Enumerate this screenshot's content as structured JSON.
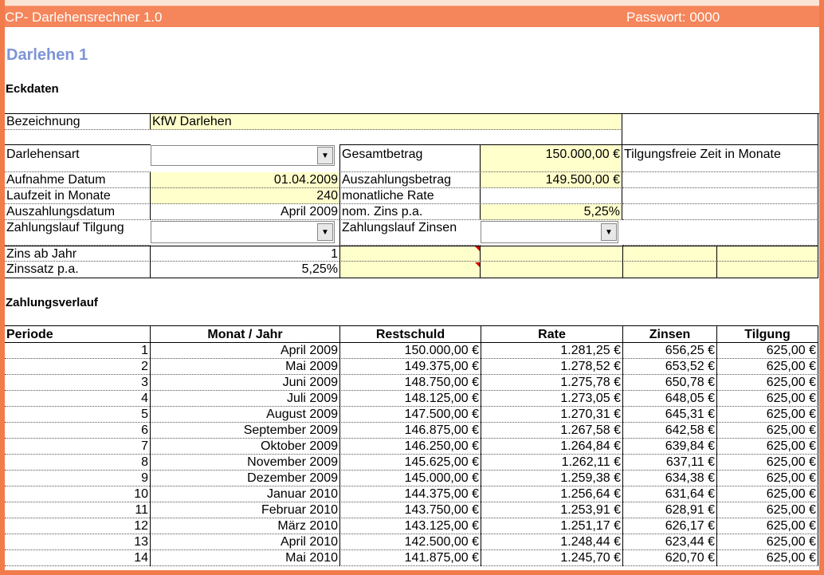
{
  "window": {
    "title": "CP- Darlehensrechner 1.0",
    "password_label": "Passwort: 0000"
  },
  "page_title": "Darlehen 1",
  "section_eckdaten": "Eckdaten",
  "section_zahlungsverlauf": "Zahlungsverlauf",
  "eckdaten": {
    "bezeichnung_label": "Bezeichnung",
    "bezeichnung_value": "KfW Darlehen",
    "darlehensart_label": "Darlehensart",
    "gesamtbetrag_label": "Gesamtbetrag",
    "gesamtbetrag_value": "150.000,00 €",
    "tilgungsfreie_label": "Tilgungsfreie Zeit in Monate",
    "aufnahme_label": "Aufnahme Datum",
    "aufnahme_value": "01.04.2009",
    "auszahlungsbetrag_label": "Auszahlungsbetrag",
    "auszahlungsbetrag_value": "149.500,00 €",
    "laufzeit_label": "Laufzeit in Monate",
    "laufzeit_value": "240",
    "monatliche_rate_label": "monatliche Rate",
    "auszahlungsdatum_label": "Auszahlungsdatum",
    "auszahlungsdatum_value": "April 2009",
    "nom_zins_label": "nom. Zins p.a.",
    "nom_zins_value": "5,25%",
    "zahlungslauf_tilgung_label": "Zahlungslauf Tilgung",
    "zahlungslauf_zinsen_label": "Zahlungslauf Zinsen",
    "zins_ab_jahr_label": "Zins ab Jahr",
    "zins_ab_jahr_value": "1",
    "zinssatz_label": "Zinssatz p.a.",
    "zinssatz_value": "5,25%"
  },
  "table": {
    "headers": [
      "Periode",
      "Monat / Jahr",
      "Restschuld",
      "Rate",
      "Zinsen",
      "Tilgung"
    ],
    "rows": [
      [
        "1",
        "April 2009",
        "150.000,00 €",
        "1.281,25 €",
        "656,25 €",
        "625,00 €"
      ],
      [
        "2",
        "Mai 2009",
        "149.375,00 €",
        "1.278,52 €",
        "653,52 €",
        "625,00 €"
      ],
      [
        "3",
        "Juni 2009",
        "148.750,00 €",
        "1.275,78 €",
        "650,78 €",
        "625,00 €"
      ],
      [
        "4",
        "Juli 2009",
        "148.125,00 €",
        "1.273,05 €",
        "648,05 €",
        "625,00 €"
      ],
      [
        "5",
        "August 2009",
        "147.500,00 €",
        "1.270,31 €",
        "645,31 €",
        "625,00 €"
      ],
      [
        "6",
        "September 2009",
        "146.875,00 €",
        "1.267,58 €",
        "642,58 €",
        "625,00 €"
      ],
      [
        "7",
        "Oktober 2009",
        "146.250,00 €",
        "1.264,84 €",
        "639,84 €",
        "625,00 €"
      ],
      [
        "8",
        "November 2009",
        "145.625,00 €",
        "1.262,11 €",
        "637,11 €",
        "625,00 €"
      ],
      [
        "9",
        "Dezember 2009",
        "145.000,00 €",
        "1.259,38 €",
        "634,38 €",
        "625,00 €"
      ],
      [
        "10",
        "Januar 2010",
        "144.375,00 €",
        "1.256,64 €",
        "631,64 €",
        "625,00 €"
      ],
      [
        "11",
        "Februar 2010",
        "143.750,00 €",
        "1.253,91 €",
        "628,91 €",
        "625,00 €"
      ],
      [
        "12",
        "März 2010",
        "143.125,00 €",
        "1.251,17 €",
        "626,17 €",
        "625,00 €"
      ],
      [
        "13",
        "April 2010",
        "142.500,00 €",
        "1.248,44 €",
        "623,44 €",
        "625,00 €"
      ],
      [
        "14",
        "Mai 2010",
        "141.875,00 €",
        "1.245,70 €",
        "620,70 €",
        "625,00 €"
      ]
    ]
  },
  "colors": {
    "accent": "#f5855a",
    "title_blue": "#7d94d6",
    "input_yellow": "#ffffcc"
  },
  "icons": {
    "dropdown": "chevron-down-icon"
  }
}
